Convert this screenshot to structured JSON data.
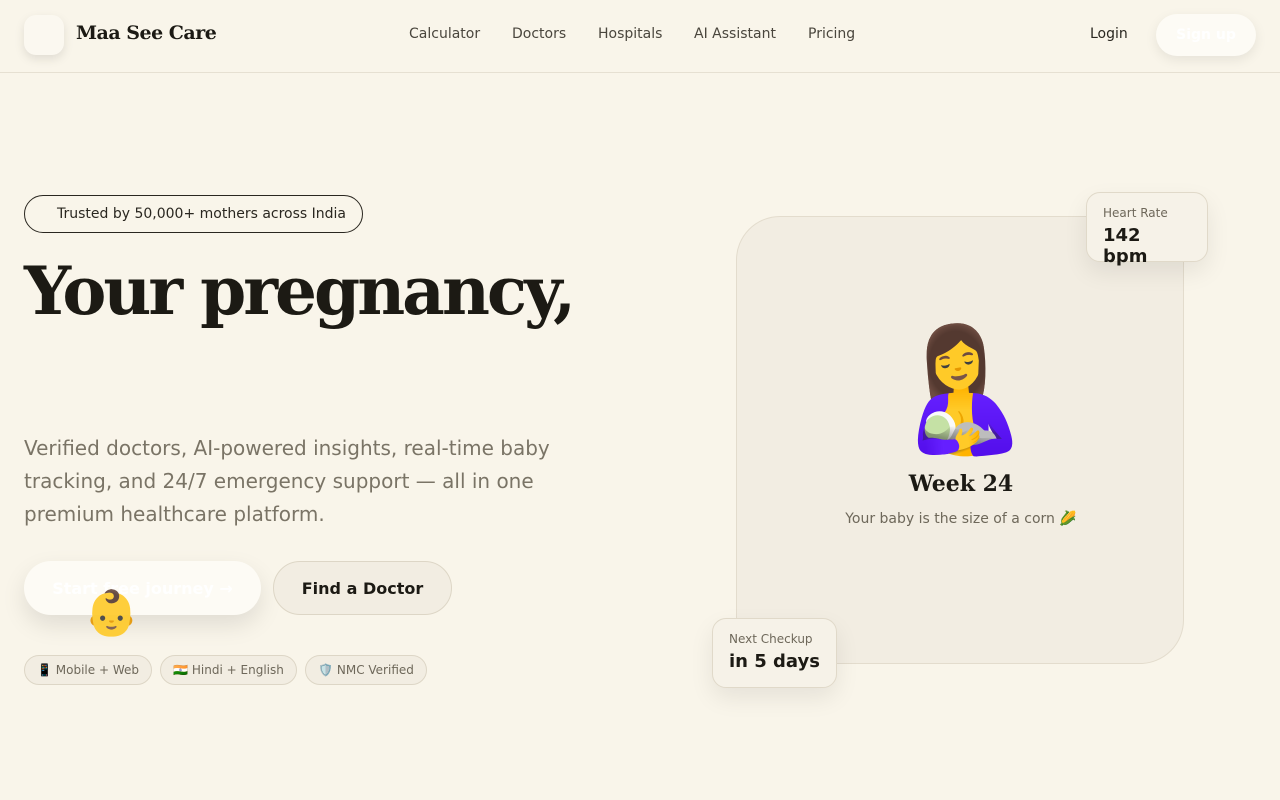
{
  "header": {
    "brand": "Maa See Care",
    "nav": [
      "Calculator",
      "Doctors",
      "Hospitals",
      "AI Assistant",
      "Pricing"
    ],
    "login": "Login",
    "signup": "Sign up"
  },
  "hero": {
    "trust_badge": "Trusted by 50,000+ mothers across India",
    "headline": "Your pregnancy,",
    "subtext": "Verified doctors, AI-powered insights, real-time baby tracking, and 24/7 emergency support — all in one premium healthcare platform.",
    "cta_primary": "Start free journey →",
    "cta_secondary": "Find a Doctor",
    "baby_emoji": "👶",
    "chips": [
      "📱 Mobile + Web",
      "🇮🇳 Hindi + English",
      "🛡️ NMC Verified"
    ]
  },
  "card": {
    "emoji": "🤱",
    "week": "Week 24",
    "size_text": "Your baby is the size of a corn 🌽",
    "heart_rate_label": "Heart Rate",
    "heart_rate_value": "142 bpm",
    "checkup_label": "Next Checkup",
    "checkup_value": "in 5 days"
  }
}
